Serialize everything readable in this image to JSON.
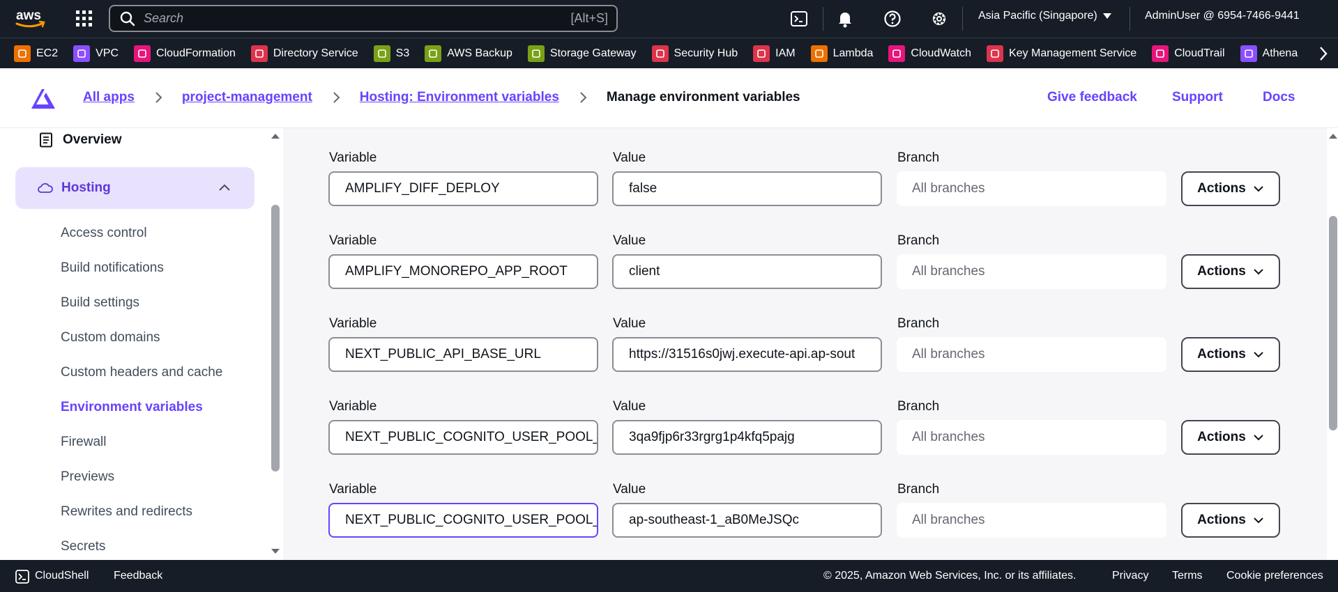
{
  "topnav": {
    "logo": "aws",
    "search_placeholder": "Search",
    "search_shortcut": "[Alt+S]",
    "region": "Asia Pacific (Singapore)",
    "account": "AdminUser @ 6954-7466-9441",
    "icons": [
      "grid-icon",
      "cloudshell-icon",
      "bell-icon",
      "help-icon",
      "gear-icon"
    ]
  },
  "favorites": [
    {
      "label": "EC2",
      "color": "#ed7100"
    },
    {
      "label": "VPC",
      "color": "#8c4fff"
    },
    {
      "label": "CloudFormation",
      "color": "#e7157b"
    },
    {
      "label": "Directory Service",
      "color": "#dd344c"
    },
    {
      "label": "S3",
      "color": "#7aa116"
    },
    {
      "label": "AWS Backup",
      "color": "#7aa116"
    },
    {
      "label": "Storage Gateway",
      "color": "#7aa116"
    },
    {
      "label": "Security Hub",
      "color": "#dd344c"
    },
    {
      "label": "IAM",
      "color": "#dd344c"
    },
    {
      "label": "Lambda",
      "color": "#ed7100"
    },
    {
      "label": "CloudWatch",
      "color": "#e7157b"
    },
    {
      "label": "Key Management Service",
      "color": "#dd344c"
    },
    {
      "label": "CloudTrail",
      "color": "#e7157b"
    },
    {
      "label": "Athena",
      "color": "#8c4fff"
    }
  ],
  "header": {
    "crumbs": [
      "All apps",
      "project-management",
      "Hosting: Environment variables"
    ],
    "current": "Manage environment variables",
    "links": [
      "Give feedback",
      "Support",
      "Docs"
    ]
  },
  "sidebar": {
    "overview": "Overview",
    "hosting": "Hosting",
    "items": [
      "Access control",
      "Build notifications",
      "Build settings",
      "Custom domains",
      "Custom headers and cache",
      "Environment variables",
      "Firewall",
      "Previews",
      "Rewrites and redirects",
      "Secrets"
    ],
    "active_item": "Environment variables"
  },
  "env": {
    "labels": {
      "variable": "Variable",
      "value": "Value",
      "branch": "Branch",
      "actions": "Actions"
    },
    "rows": [
      {
        "variable": "AMPLIFY_DIFF_DEPLOY",
        "value": "false",
        "branch": "All branches"
      },
      {
        "variable": "AMPLIFY_MONOREPO_APP_ROOT",
        "value": "client",
        "branch": "All branches"
      },
      {
        "variable": "NEXT_PUBLIC_API_BASE_URL",
        "value": "https://31516s0jwj.execute-api.ap-sout",
        "branch": "All branches"
      },
      {
        "variable": "NEXT_PUBLIC_COGNITO_USER_POOL_(",
        "value": "3qa9fjp6r33rgrg1p4kfq5pajg",
        "branch": "All branches"
      },
      {
        "variable": "NEXT_PUBLIC_COGNITO_USER_POOL_I",
        "value": "ap-southeast-1_aB0MeJSQc",
        "branch": "All branches"
      }
    ]
  },
  "footer": {
    "cloudshell": "CloudShell",
    "feedback": "Feedback",
    "copyright": "© 2025, Amazon Web Services, Inc. or its affiliates.",
    "privacy": "Privacy",
    "terms": "Terms",
    "cookies": "Cookie preferences"
  }
}
